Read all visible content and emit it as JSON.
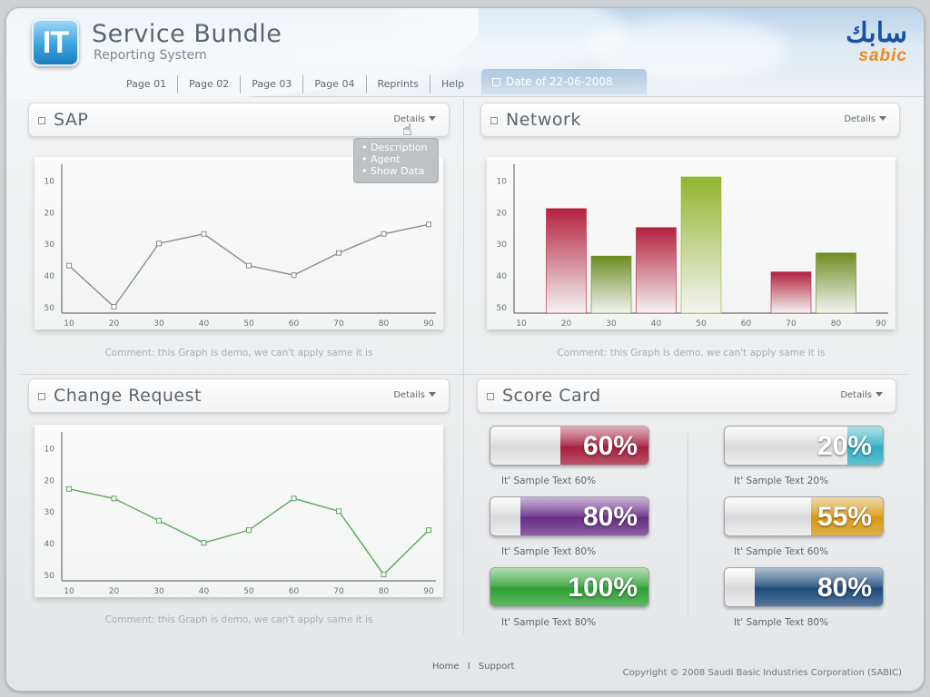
{
  "header": {
    "logo_text": "IT",
    "title": "Service Bundle",
    "subtitle": "Reporting System",
    "nav": [
      "Page 01",
      "Page 02",
      "Page 03",
      "Page 04",
      "Reprints",
      "Help"
    ],
    "date_label": "Date of 22-06-2008",
    "brand_arabic": "سابك",
    "brand_latin": "sabic"
  },
  "panels": {
    "sap": {
      "title": "SAP",
      "details_label": "Details",
      "comment": "Comment: this Graph is demo, we can't apply same it is"
    },
    "network": {
      "title": "Network",
      "details_label": "Details",
      "comment": "Comment: this Graph is demo, we can't apply same it is"
    },
    "change_request": {
      "title": "Change Request",
      "details_label": "Details",
      "comment": "Comment: this Graph is demo, we can't apply same it is"
    },
    "score_card": {
      "title": "Score Card",
      "details_label": "Details"
    }
  },
  "dropdown": {
    "items": [
      "• Description",
      "• Agent",
      "• Show Data"
    ]
  },
  "chart_data": [
    {
      "type": "line",
      "x": [
        10,
        20,
        30,
        40,
        50,
        60,
        70,
        80,
        90
      ],
      "series": [
        {
          "values": [
            37,
            50,
            30,
            27,
            37,
            40,
            33,
            27,
            24
          ]
        }
      ],
      "yticks": [
        10,
        20,
        30,
        40,
        50
      ],
      "ylim": [
        5,
        52
      ],
      "y_inverted": true,
      "color": "#8a8d90"
    },
    {
      "type": "bar",
      "x": [
        10,
        20,
        30,
        40,
        50,
        60,
        70,
        80,
        90
      ],
      "yticks": [
        10,
        20,
        30,
        40,
        50
      ],
      "ylim": [
        5,
        52
      ],
      "y_inverted": true,
      "bars": [
        {
          "x": 20,
          "value": 19,
          "color": "#b3213f"
        },
        {
          "x": 30,
          "value": 34,
          "color": "#6e8b22"
        },
        {
          "x": 40,
          "value": 25,
          "color": "#b3213f"
        },
        {
          "x": 50,
          "value": 9,
          "color": "#93b52c"
        },
        {
          "x": 70,
          "value": 39,
          "color": "#b3213f"
        },
        {
          "x": 80,
          "value": 33,
          "color": "#6e8b22"
        }
      ]
    },
    {
      "type": "line",
      "x": [
        10,
        20,
        30,
        40,
        50,
        60,
        70,
        80,
        90
      ],
      "series": [
        {
          "values": [
            23,
            26,
            33,
            40,
            36,
            26,
            30,
            50,
            36
          ]
        }
      ],
      "yticks": [
        10,
        20,
        30,
        40,
        50
      ],
      "ylim": [
        5,
        52
      ],
      "y_inverted": true,
      "color": "#5fa55d"
    }
  ],
  "score_card": {
    "gauges": [
      {
        "value": "60%",
        "fraction": 0.55,
        "label": "It' Sample Text 60%",
        "color": "#a8203f"
      },
      {
        "value": "20%",
        "fraction": 0.22,
        "label": "It' Sample Text 20%",
        "color": "#2fb0c4"
      },
      {
        "value": "80%",
        "fraction": 0.8,
        "label": "It' Sample Text 80%",
        "color": "#6a2e8a"
      },
      {
        "value": "55%",
        "fraction": 0.45,
        "label": "It' Sample Text 60%",
        "color": "#d89a12"
      },
      {
        "value": "100%",
        "fraction": 1.0,
        "label": "It' Sample Text 80%",
        "color": "#2fa234"
      },
      {
        "value": "80%",
        "fraction": 0.8,
        "label": "It' Sample Text 80%",
        "color": "#1f4d7c"
      }
    ]
  },
  "footer": {
    "home": "Home",
    "separator": "I",
    "support": "Support",
    "copyright": "Copyright © 2008 Saudi Basic Industries Corporation (SABIC)"
  }
}
